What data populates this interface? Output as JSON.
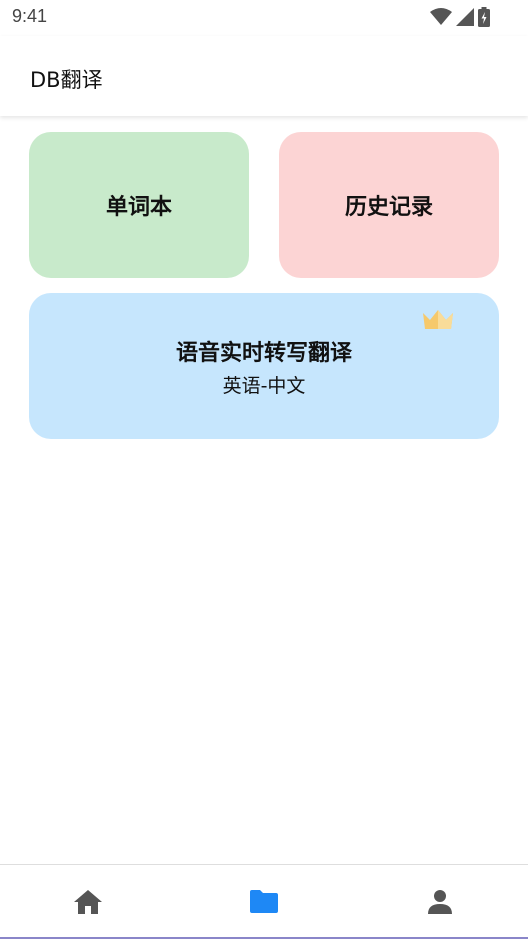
{
  "status_bar": {
    "time": "9:41",
    "icons": [
      "wifi-icon",
      "cell-signal-icon",
      "battery-icon"
    ]
  },
  "app_bar": {
    "title": "DB翻译"
  },
  "cards": {
    "wordbook": {
      "label": "单词本",
      "color": "#c8eacb"
    },
    "history": {
      "label": "历史记录",
      "color": "#fcd4d4"
    },
    "voice": {
      "label": "语音实时转写翻译",
      "sublabel": "英语-中文",
      "badge_icon": "crown-icon",
      "color": "#c6e6fd"
    }
  },
  "bottom_nav": {
    "items": [
      {
        "icon": "home-icon",
        "active": false
      },
      {
        "icon": "folder-icon",
        "active": true
      },
      {
        "icon": "person-icon",
        "active": false
      }
    ],
    "active_color": "#1e88f5",
    "inactive_color": "#555555"
  }
}
